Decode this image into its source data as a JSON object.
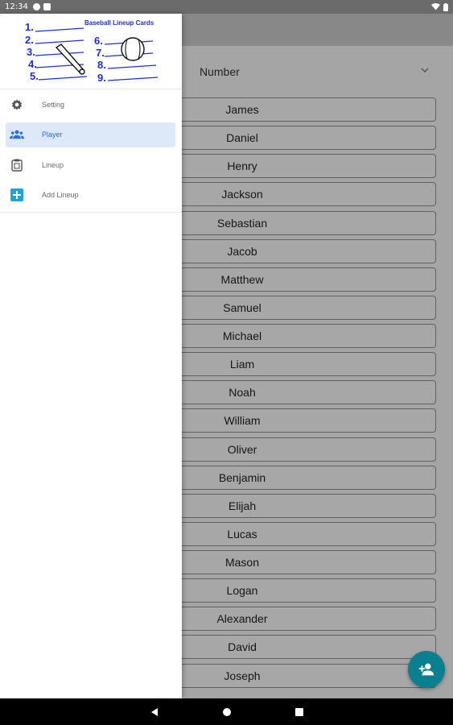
{
  "status_bar": {
    "time": "12:34",
    "icons": [
      "g-icon",
      "sim-icon",
      "wifi-icon",
      "battery-icon"
    ]
  },
  "sort": {
    "selected": "Number"
  },
  "players": [
    "James",
    "Daniel",
    "Henry",
    "Jackson",
    "Sebastian",
    "Jacob",
    "Matthew",
    "Samuel",
    "Michael",
    "Liam",
    "Noah",
    "William",
    "Oliver",
    "Benjamin",
    "Elijah",
    "Lucas",
    "Mason",
    "Logan",
    "Alexander",
    "David",
    "Joseph"
  ],
  "drawer": {
    "header_title": "Baseball Lineup Cards",
    "header_numbers": [
      "1.",
      "2.",
      "3.",
      "4.",
      "5.",
      "6.",
      "7.",
      "8.",
      "9."
    ],
    "items": [
      {
        "label": "Setting",
        "icon": "gear-icon",
        "active": false
      },
      {
        "label": "Player",
        "icon": "people-icon",
        "active": true
      },
      {
        "label": "Lineup",
        "icon": "clipboard-icon",
        "active": false
      },
      {
        "label": "Add Lineup",
        "icon": "add-box-icon",
        "active": false
      }
    ]
  },
  "fab": {
    "icon": "add-person-icon"
  },
  "colors": {
    "accent": "#2a6fd6",
    "fab": "#0a7f8f",
    "header_ink": "#1f2fd0"
  },
  "system_nav": [
    "back-icon",
    "home-icon",
    "recents-icon"
  ]
}
